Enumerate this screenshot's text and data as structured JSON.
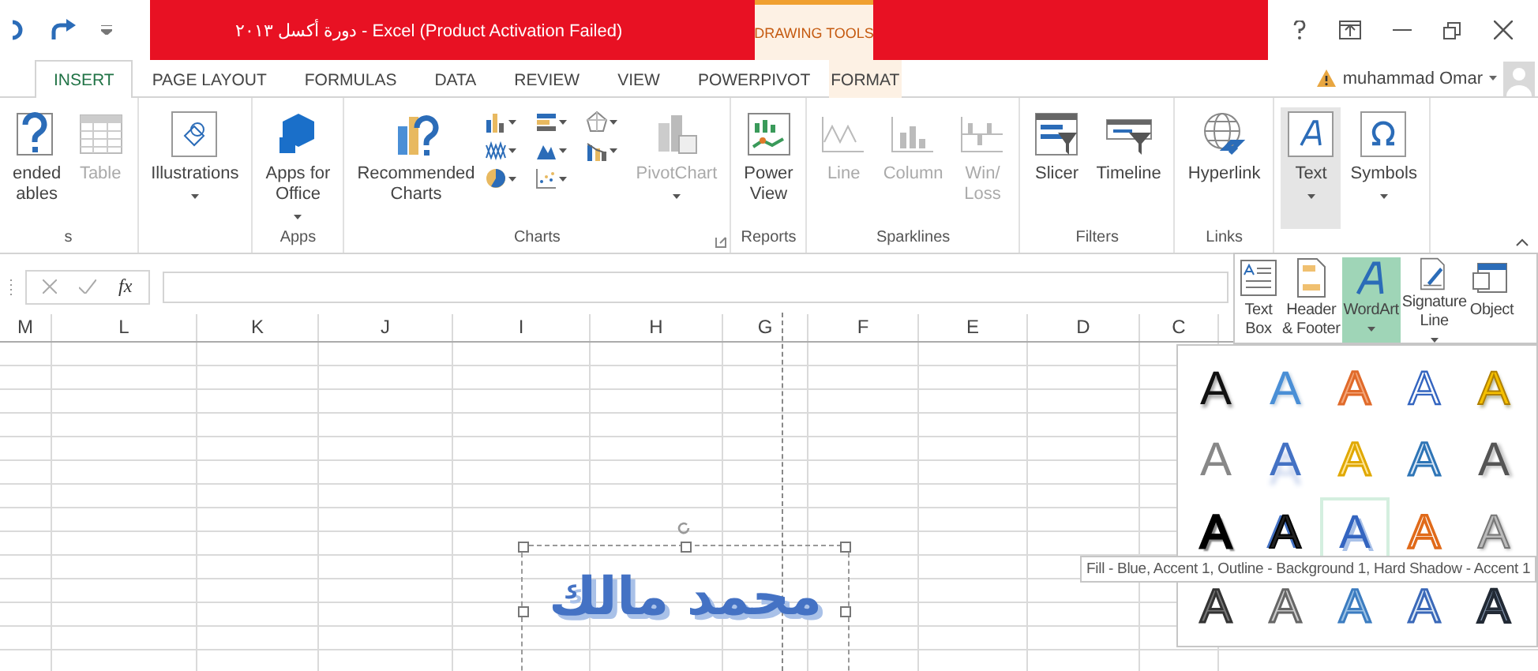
{
  "window": {
    "title": "دورة أكسل ٢٠١٣ - Excel (Product Activation Failed)",
    "contextual_header": "DRAWING TOOLS"
  },
  "tabs": [
    {
      "label": "INSERT",
      "selected": true,
      "contextual": false
    },
    {
      "label": "PAGE LAYOUT",
      "selected": false,
      "contextual": false
    },
    {
      "label": "FORMULAS",
      "selected": false,
      "contextual": false
    },
    {
      "label": "DATA",
      "selected": false,
      "contextual": false
    },
    {
      "label": "REVIEW",
      "selected": false,
      "contextual": false
    },
    {
      "label": "VIEW",
      "selected": false,
      "contextual": false
    },
    {
      "label": "POWERPIVOT",
      "selected": false,
      "contextual": false
    },
    {
      "label": "FORMAT",
      "selected": false,
      "contextual": true
    }
  ],
  "account": {
    "user": "muhammad Omar"
  },
  "ribbon_groups": [
    {
      "label": "s",
      "launcher": false,
      "buttons": [
        {
          "kind": "large",
          "label": "ended\nables",
          "dropdown": false,
          "disabled": false,
          "selected": false
        },
        {
          "kind": "large",
          "label": "Table",
          "dropdown": false,
          "disabled": true,
          "selected": false
        }
      ]
    },
    {
      "launcher": false,
      "buttons": [
        {
          "kind": "large",
          "label": "Illustrations",
          "dropdown": true,
          "disabled": false,
          "selected": false
        }
      ]
    },
    {
      "label": "Apps",
      "launcher": false,
      "buttons": [
        {
          "kind": "large",
          "label": "Apps for\nOffice",
          "dropdown": true,
          "disabled": false,
          "selected": false
        }
      ]
    },
    {
      "label": "Charts",
      "launcher": true,
      "buttons": [
        {
          "kind": "large",
          "label": "Recommended\nCharts",
          "dropdown": false,
          "disabled": false,
          "selected": false
        },
        {
          "kind": "chart-gallery"
        },
        {
          "kind": "large",
          "label": "PivotChart",
          "dropdown": true,
          "disabled": true,
          "selected": false
        }
      ]
    },
    {
      "label": "Reports",
      "launcher": false,
      "buttons": [
        {
          "kind": "large",
          "label": "Power\nView",
          "dropdown": false,
          "disabled": false,
          "selected": false
        }
      ]
    },
    {
      "label": "Sparklines",
      "launcher": false,
      "buttons": [
        {
          "kind": "large",
          "label": "Line",
          "dropdown": false,
          "disabled": true,
          "selected": false
        },
        {
          "kind": "large",
          "label": "Column",
          "dropdown": false,
          "disabled": true,
          "selected": false
        },
        {
          "kind": "large",
          "label": "Win/\nLoss",
          "dropdown": false,
          "disabled": true,
          "selected": false
        }
      ]
    },
    {
      "label": "Filters",
      "launcher": false,
      "buttons": [
        {
          "kind": "large",
          "label": "Slicer",
          "dropdown": false,
          "disabled": false,
          "selected": false
        },
        {
          "kind": "large",
          "label": "Timeline",
          "dropdown": false,
          "disabled": false,
          "selected": false
        }
      ]
    },
    {
      "label": "Links",
      "launcher": false,
      "buttons": [
        {
          "kind": "large",
          "label": "Hyperlink",
          "dropdown": false,
          "disabled": false,
          "selected": false
        }
      ]
    },
    {
      "launcher": false,
      "buttons": [
        {
          "kind": "large",
          "label": "Text",
          "dropdown": true,
          "disabled": false,
          "selected": true
        },
        {
          "kind": "large",
          "label": "Symbols",
          "dropdown": true,
          "disabled": false,
          "selected": false
        }
      ]
    }
  ],
  "formula_bar": {
    "function_label": "fx"
  },
  "columns": [
    "M",
    "L",
    "K",
    "J",
    "I",
    "H",
    "G",
    "F",
    "E",
    "D",
    "C"
  ],
  "wordart": {
    "text": "محمد مالك"
  },
  "text_menu": {
    "items": [
      {
        "label": "Text\nBox",
        "dropdown": false,
        "selected": false
      },
      {
        "label": "Header\n& Footer",
        "dropdown": false,
        "selected": false
      },
      {
        "label": "WordArt",
        "dropdown": true,
        "selected": true
      },
      {
        "label": "Signature\nLine",
        "dropdown": true,
        "selected": false
      },
      {
        "label": "Object",
        "dropdown": false,
        "selected": false
      }
    ]
  },
  "wordart_gallery": {
    "styles": [
      {
        "label": "A",
        "kind": "black-shadow",
        "selected": false
      },
      {
        "label": "A",
        "kind": "blue-fill",
        "selected": false
      },
      {
        "label": "A",
        "kind": "orange-outline",
        "selected": false
      },
      {
        "label": "A",
        "kind": "blue-outline",
        "selected": false
      },
      {
        "label": "A",
        "kind": "gold",
        "selected": false
      },
      {
        "label": "A",
        "kind": "gray",
        "selected": false
      },
      {
        "label": "A",
        "kind": "blue-reflection",
        "selected": false
      },
      {
        "label": "A",
        "kind": "yellow-outline",
        "selected": false
      },
      {
        "label": "A",
        "kind": "light-blue-outline",
        "selected": false
      },
      {
        "label": "A",
        "kind": "gray-gradient",
        "selected": false
      },
      {
        "label": "A",
        "kind": "black-bold",
        "selected": false
      },
      {
        "label": "A",
        "kind": "black-blue",
        "selected": false
      },
      {
        "label": "A",
        "kind": "blue-hard-shadow",
        "selected": true
      },
      {
        "label": "A",
        "kind": "orange-white",
        "selected": false
      },
      {
        "label": "A",
        "kind": "silver",
        "selected": false
      },
      {
        "label": "A",
        "kind": "dark-pattern",
        "selected": false
      },
      {
        "label": "A",
        "kind": "gray-pattern",
        "selected": false
      },
      {
        "label": "A",
        "kind": "blue-pattern",
        "selected": false
      },
      {
        "label": "A",
        "kind": "blue-line-pattern",
        "selected": false
      },
      {
        "label": "A",
        "kind": "navy-pattern",
        "selected": false
      }
    ]
  },
  "tooltip": {
    "text": "Fill - Blue, Accent 1, Outline - Background 1, Hard Shadow - Accent 1"
  }
}
